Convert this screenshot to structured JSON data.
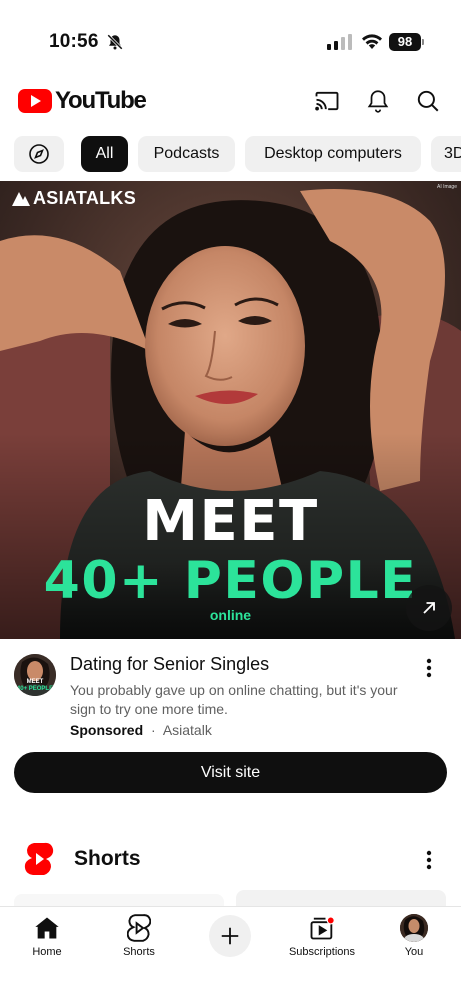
{
  "status_bar": {
    "time": "10:56",
    "battery": "98",
    "icons": [
      "bell-slash-icon",
      "signal-icon",
      "wifi-icon",
      "battery-icon"
    ]
  },
  "header": {
    "logo_text": "YouTube",
    "icons": [
      "cast-icon",
      "notifications-icon",
      "search-icon"
    ]
  },
  "chips": {
    "explore_icon": "compass-icon",
    "items": [
      "All",
      "Podcasts",
      "Desktop computers",
      "3D"
    ],
    "selected": "All"
  },
  "ad": {
    "brand": "ASIATALKS",
    "ai_tag": "AI Image",
    "headline_1": "MEET",
    "headline_2": "40+ PEOPLE",
    "headline_3": "online",
    "title": "Dating for Senior Singles",
    "description": "You probably gave up on online chatting, but it's your sign to try one more time.",
    "sponsored": "Sponsored",
    "separator": "·",
    "advertiser": "Asiatalk",
    "cta": "Visit site",
    "avatar_text_1": "MEET",
    "avatar_text_2": "40+ PEOPLE"
  },
  "shorts": {
    "title": "Shorts"
  },
  "bottom_nav": {
    "home": "Home",
    "shorts": "Shorts",
    "subscriptions": "Subscriptions",
    "you": "You"
  },
  "colors": {
    "brand_red": "#ff0000",
    "ad_green": "#2ce39a",
    "text_primary": "#0f0f0f",
    "text_secondary": "#606060"
  }
}
